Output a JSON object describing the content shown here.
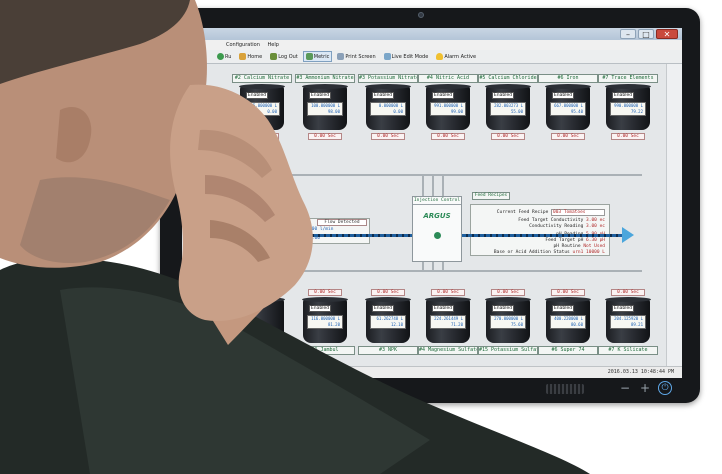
{
  "window": {
    "menu": [
      "Configuration",
      "Help"
    ],
    "controls": [
      "–",
      "□",
      "✕"
    ],
    "status_time": "2016.03.13 10:48:44 PM"
  },
  "toolbar": {
    "items": [
      {
        "label": "Ru"
      },
      {
        "label": "Home"
      },
      {
        "label": "Log Out"
      },
      {
        "label": "Metric"
      },
      {
        "label": "Print Screen"
      },
      {
        "label": "Live Edit Mode"
      },
      {
        "label": "Alarm Active"
      }
    ]
  },
  "top_tanks": [
    {
      "name": "#2 Calcium Nitrate",
      "state": "Enabled",
      "readout_1": "5.000000 L",
      "readout_2": "0.00",
      "time": "0.00 Sec"
    },
    {
      "name": "#3 Ammonium Nitrate",
      "state": "Enabled",
      "readout_1": "100.000000 L",
      "readout_2": "98.00",
      "time": "0.00 Sec"
    },
    {
      "name": "#3 Potassium Nitrate",
      "state": "Enabled",
      "readout_1": "0.000000 L",
      "readout_2": "0.00",
      "time": "0.00 Sec"
    },
    {
      "name": "#4 Nitric Acid",
      "state": "Enabled",
      "readout_1": "991.000000 L",
      "readout_2": "99.00",
      "time": "0.00 Sec"
    },
    {
      "name": "#5 Calcium Chloride",
      "state": "Enabled",
      "readout_1": "282.003273 L",
      "readout_2": "55.00",
      "time": "0.00 Sec"
    },
    {
      "name": "#6 Iron",
      "state": "Enabled",
      "readout_1": "667.000000 L",
      "readout_2": "95.40",
      "time": "0.00 Sec"
    },
    {
      "name": "#7 Trace Elements",
      "state": "Enabled",
      "readout_1": "990.000000 L",
      "readout_2": "79.22",
      "time": "0.00 Sec"
    }
  ],
  "bottom_tanks": [
    {
      "name": "Magnesium Nitrate",
      "state": "",
      "readout_1": "",
      "readout_2": "",
      "time": ""
    },
    {
      "name": "#1 Jambul",
      "state": "Enabled",
      "readout_1": "116.000000 L",
      "readout_2": "81.20",
      "time": "0.00 Sec"
    },
    {
      "name": "#3 NPK",
      "state": "Enabled",
      "readout_1": "61.262748 L",
      "readout_2": "12.10",
      "time": "0.00 Sec"
    },
    {
      "name": "#4 Magnesium Sulfate",
      "state": "Enabled",
      "readout_1": "224.261449 L",
      "readout_2": "71.20",
      "time": "0.00 Sec"
    },
    {
      "name": "#15 Potassium Sulfate",
      "state": "Enabled",
      "readout_1": "270.000000 L",
      "readout_2": "75.60",
      "time": "0.00 Sec"
    },
    {
      "name": "#6 Super 74",
      "state": "Enabled",
      "readout_1": "400.220000 L",
      "readout_2": "80.60",
      "time": "0.00 Sec"
    },
    {
      "name": "#7 K Silicate",
      "state": "Enabled",
      "readout_1": "204.125920 L",
      "readout_2": "89.21",
      "time": "0.00 Sec"
    }
  ],
  "injection": {
    "title": "Injection Control",
    "logo": "ARGUS"
  },
  "flow": {
    "label": "Flow Detected",
    "rate_label": "w Rate LPM",
    "rate_value": "90.000000 l/min",
    "timer_label": "ection Timer",
    "timer_value": "00:00:00"
  },
  "feed": {
    "tab": "Feed Recipes",
    "current_label": "Current Feed Recipe",
    "current_value": "003 Tomatoes",
    "rows": [
      {
        "label": "Feed Target Conductivity",
        "value": "3.00 ec"
      },
      {
        "label": "Conductivity Reading",
        "value": "3.00 ec"
      },
      {
        "label": "pH Reading",
        "value": "5.90 pH"
      },
      {
        "label": "Feed Target pH",
        "value": "6.30 pH"
      },
      {
        "label": "pH Routine",
        "value": "Not Used"
      },
      {
        "label": "Base or Acid Addition Status",
        "value": "urn1 10000 L"
      }
    ]
  }
}
